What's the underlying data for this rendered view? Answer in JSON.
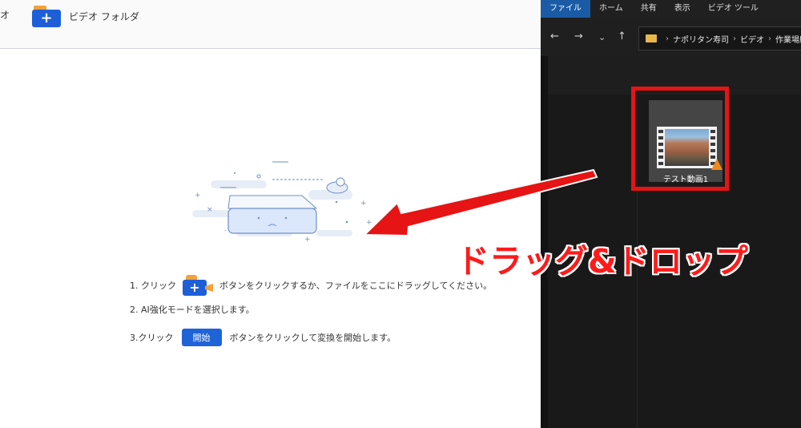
{
  "app": {
    "toolbar": {
      "left_label": "オ",
      "video_folder_label": "ビデオ フォルダ"
    },
    "steps": {
      "s1_prefix": "1. クリック",
      "s1_suffix": "ボタンをクリックするか、ファイルをここにドラッグしてください。",
      "s2_text": "2. AI強化モードを選択します。",
      "s3_prefix": "3.クリック",
      "s3_button": "開始",
      "s3_suffix": "ボタンをクリックして変換を開始します。"
    }
  },
  "explorer": {
    "ribbon_tabs": [
      "ファイル",
      "ホーム",
      "共有",
      "表示",
      "ビデオ ツール"
    ],
    "address_segments": [
      "ナポリタン寿司",
      "ビデオ",
      "作業場所"
    ],
    "file_name": "テスト動画1"
  },
  "overlay": {
    "caption": "ドラッグ&ドロップ",
    "accent_color": "#e61414"
  },
  "icons": [
    "folder-plus-icon",
    "video-add-icon",
    "back-arrow-icon",
    "forward-arrow-icon",
    "dropdown-chevron-icon",
    "up-arrow-icon",
    "folder-icon",
    "vlc-cone-icon"
  ]
}
